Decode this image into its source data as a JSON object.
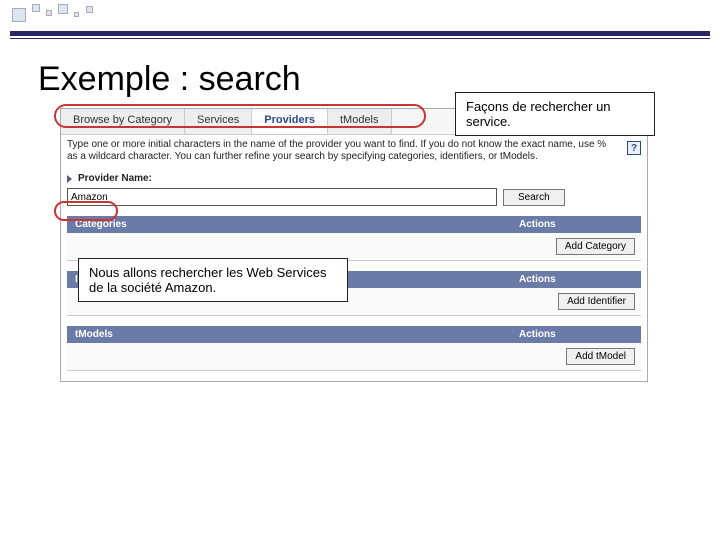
{
  "slide": {
    "title": "Exemple : search"
  },
  "callouts": {
    "top": "Façons de rechercher un service.",
    "left": "Nous allons rechercher les Web Services de la société Amazon."
  },
  "tabs": {
    "browse": "Browse by Category",
    "services": "Services",
    "providers": "Providers",
    "tmodels": "tModels"
  },
  "instructions": "Type one or more initial characters in the name of the provider you want to find. If you do not know the exact name, use % as a wildcard character. You can further refine your search by specifying categories, identifiers, or tModels.",
  "help_icon": "?",
  "provider": {
    "label": "Provider Name:",
    "value": "Amazon",
    "search_btn": "Search"
  },
  "sections": {
    "actions_header": "Actions",
    "categories": {
      "header": "Categories",
      "btn": "Add Category"
    },
    "identifiers": {
      "header": "Identifiers",
      "btn": "Add Identifier"
    },
    "tmodels": {
      "header": "tModels",
      "btn": "Add tModel"
    }
  }
}
